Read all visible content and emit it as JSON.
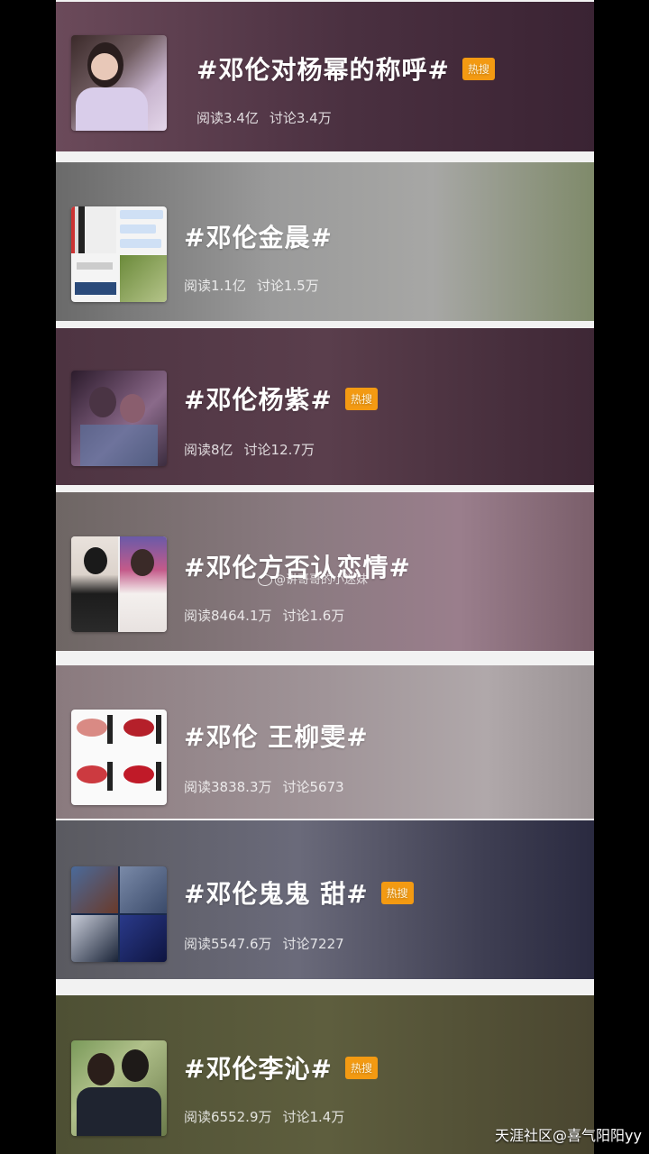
{
  "topics": [
    {
      "title": "#邓伦对杨幂的称呼#",
      "hot": true,
      "read": "阅读3.4亿",
      "discuss": "讨论3.4万",
      "badge": "热搜"
    },
    {
      "title": "#邓伦金晨#",
      "hot": false,
      "read": "阅读1.1亿",
      "discuss": "讨论1.5万"
    },
    {
      "title": "#邓伦杨紫#",
      "hot": true,
      "read": "阅读8亿",
      "discuss": "讨论12.7万",
      "badge": "热搜"
    },
    {
      "title": "#邓伦方否认恋情#",
      "hot": false,
      "read": "阅读8464.1万",
      "discuss": "讨论1.6万"
    },
    {
      "title": "#邓伦 王柳雯#",
      "hot": false,
      "read": "阅读3838.3万",
      "discuss": "讨论5673"
    },
    {
      "title": "#邓伦鬼鬼 甜#",
      "hot": true,
      "read": "阅读5547.6万",
      "discuss": "讨论7227",
      "badge": "热搜"
    },
    {
      "title": "#邓伦李沁#",
      "hot": true,
      "read": "阅读6552.9万",
      "discuss": "讨论1.4万",
      "badge": "热搜"
    }
  ],
  "watermark": "@讲哥哥的小迷妹",
  "credit": "天涯社区@喜气阳阳yy",
  "colors": {
    "badge": "#f39a12",
    "page_bg": "#000000"
  }
}
